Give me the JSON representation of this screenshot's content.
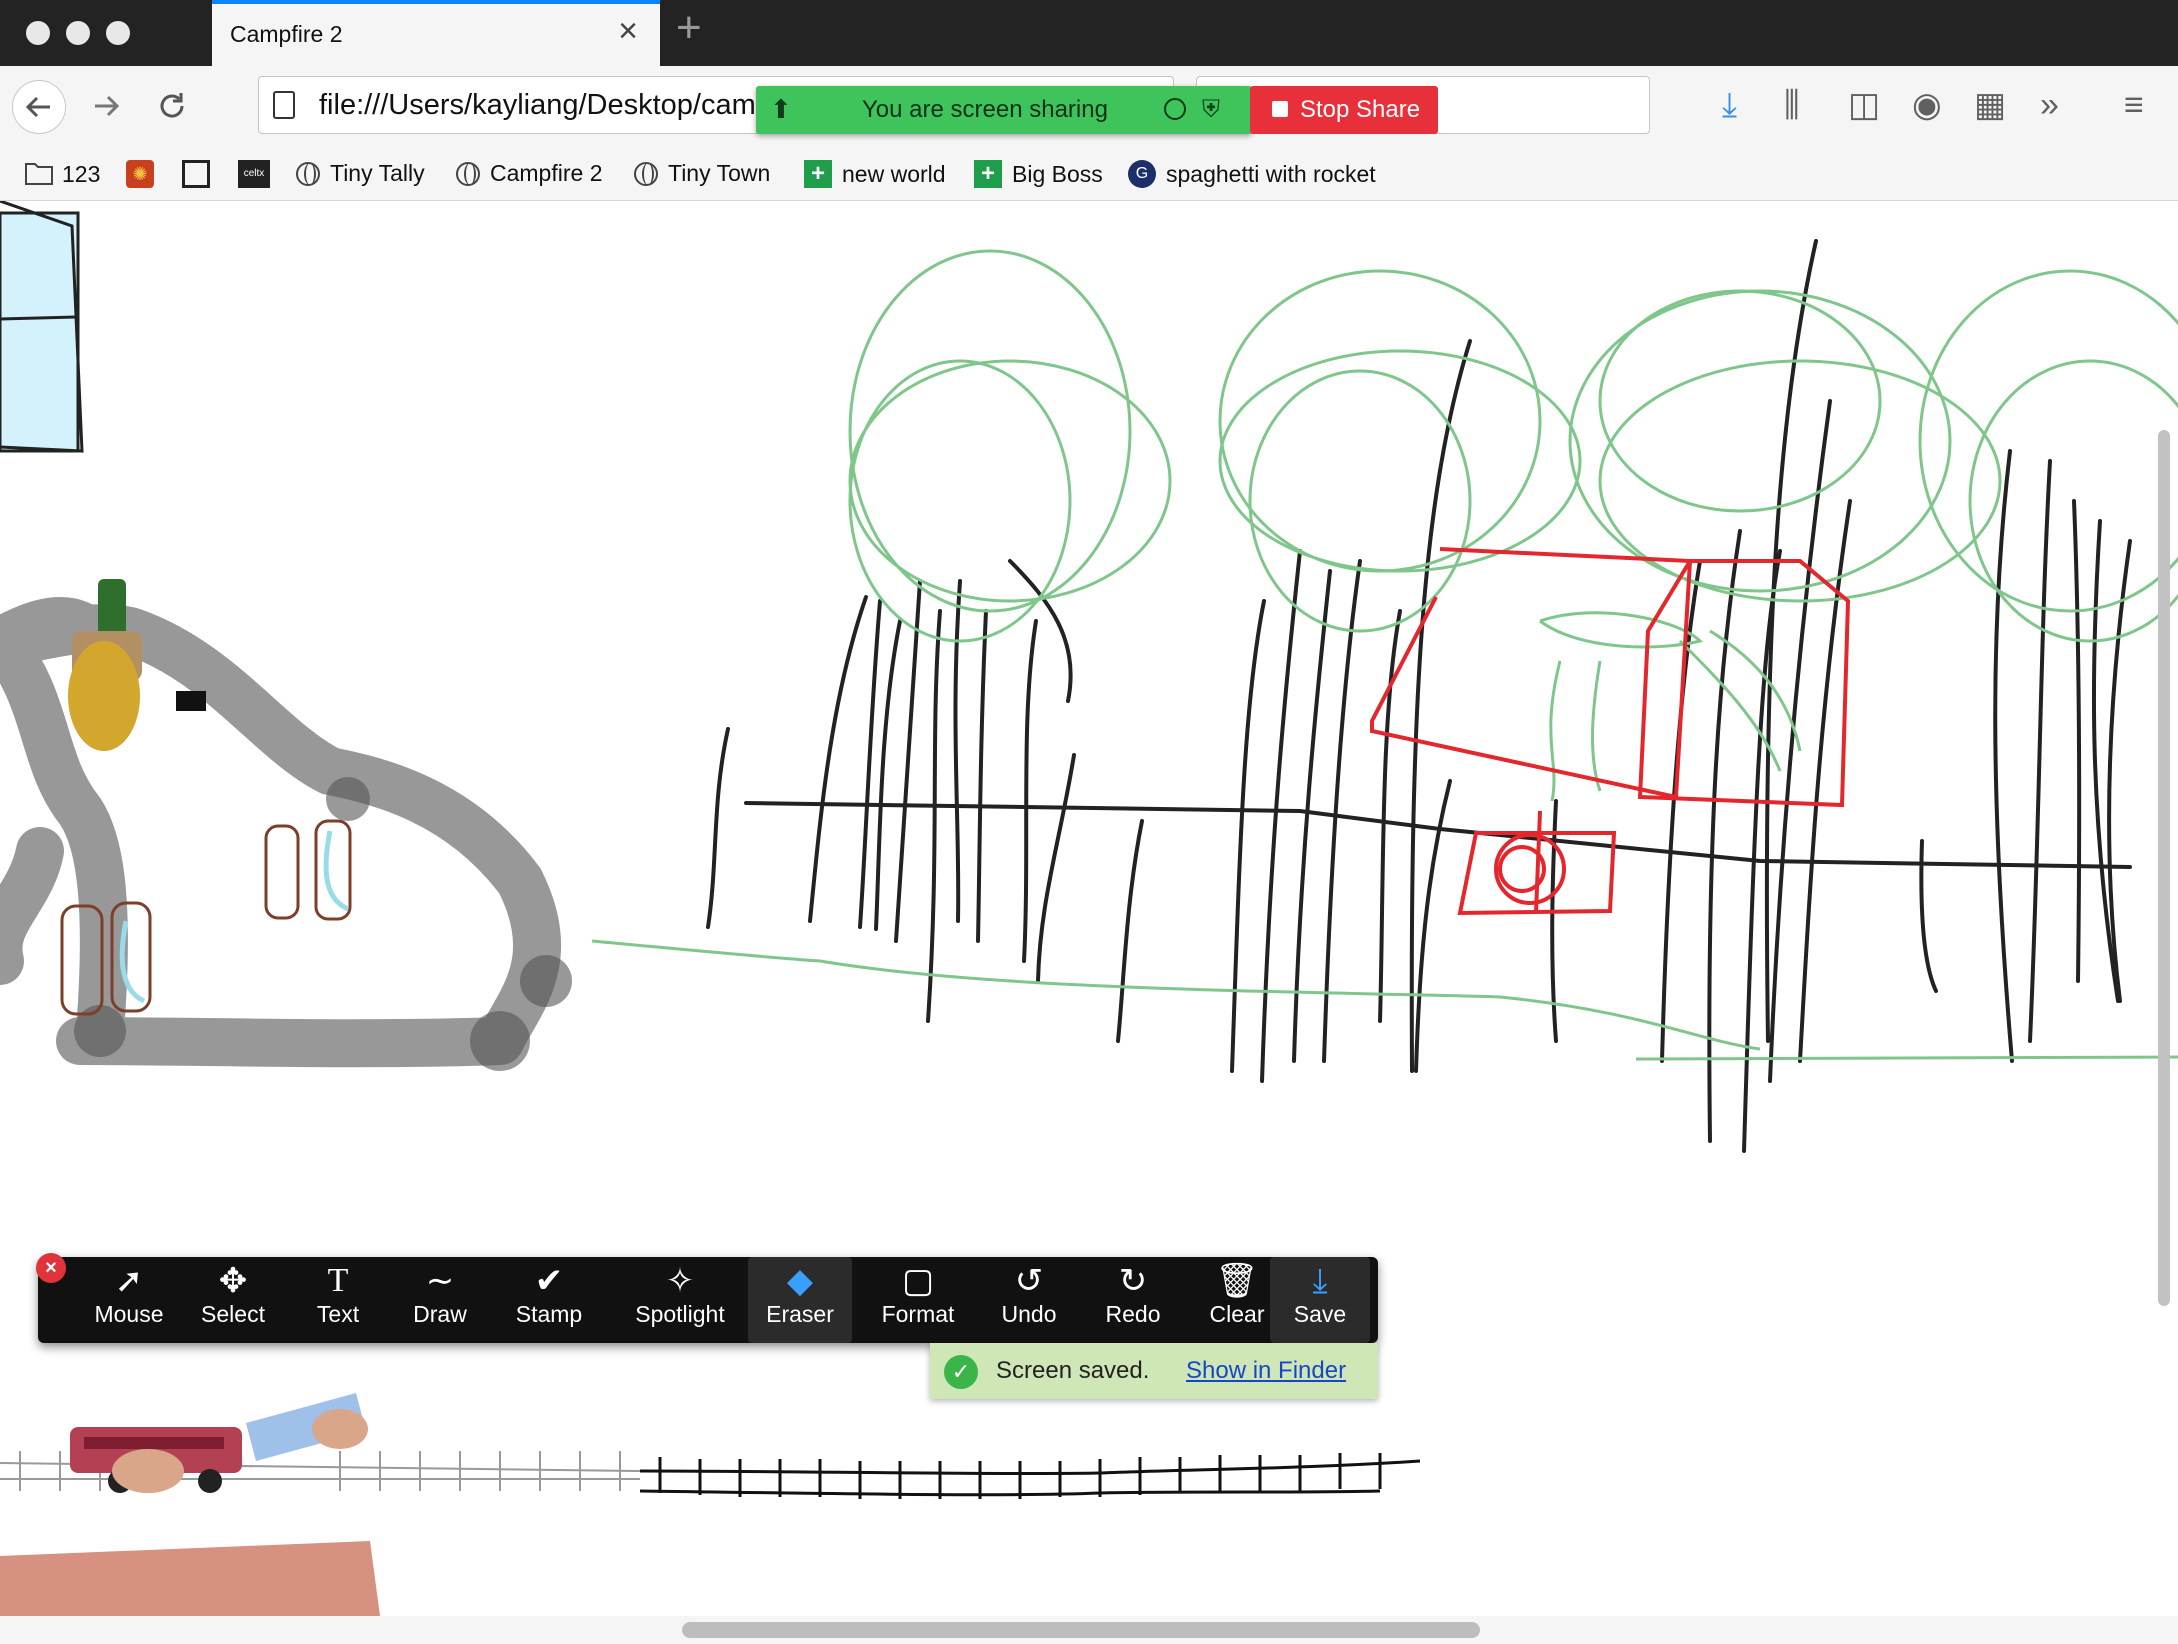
{
  "browser": {
    "tab_title": "Campfire 2",
    "url": "file:///Users/kayliang/Desktop/cam",
    "tab_close_icon": "close-icon",
    "new_tab_icon": "plus-icon"
  },
  "zoom_share": {
    "sharing_text": "You are screen sharing",
    "stop_label": "Stop Share",
    "accent_green": "#3ec45a",
    "stop_red": "#e8303a"
  },
  "bookmarks": [
    {
      "label": "123",
      "icon": "folder-icon"
    },
    {
      "label": "",
      "icon": "pumpkin-icon"
    },
    {
      "label": "",
      "icon": "frame-icon"
    },
    {
      "label": "celtx",
      "icon": "celtx-logo"
    },
    {
      "label": "Tiny Tally",
      "icon": "globe-icon"
    },
    {
      "label": "Campfire 2",
      "icon": "globe-icon"
    },
    {
      "label": "Tiny Town",
      "icon": "globe-icon"
    },
    {
      "label": "new world",
      "icon": "plus-square-icon"
    },
    {
      "label": "Big Boss",
      "icon": "plus-square-icon"
    },
    {
      "label": "spaghetti with rocket",
      "icon": "circle-logo-icon"
    }
  ],
  "annotation_toolbar": {
    "tools": [
      {
        "label": "Mouse",
        "icon": "cursor-icon"
      },
      {
        "label": "Select",
        "icon": "move-icon"
      },
      {
        "label": "Text",
        "icon": "text-icon"
      },
      {
        "label": "Draw",
        "icon": "squiggle-icon"
      },
      {
        "label": "Stamp",
        "icon": "check-icon"
      },
      {
        "label": "Spotlight",
        "icon": "wand-icon"
      },
      {
        "label": "Eraser",
        "icon": "eraser-icon"
      },
      {
        "label": "Format",
        "icon": "square-icon"
      },
      {
        "label": "Undo",
        "icon": "undo-icon"
      },
      {
        "label": "Redo",
        "icon": "redo-icon"
      },
      {
        "label": "Clear",
        "icon": "trash-icon"
      },
      {
        "label": "Save",
        "icon": "save-icon"
      }
    ],
    "active_tool": "Eraser"
  },
  "toast": {
    "message": "Screen saved.",
    "link": "Show in Finder"
  }
}
